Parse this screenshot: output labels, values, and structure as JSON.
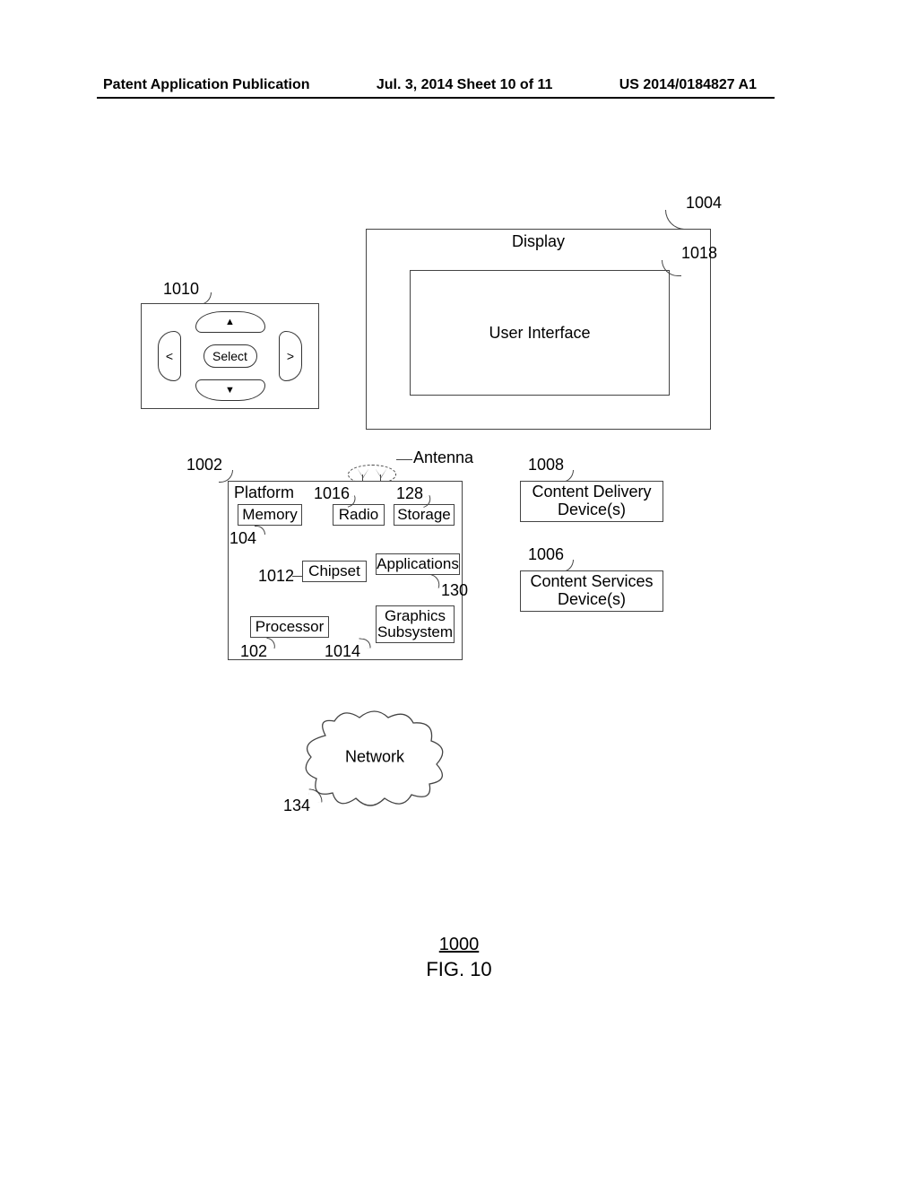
{
  "header": {
    "left": "Patent Application Publication",
    "middle": "Jul. 3, 2014  Sheet 10 of 11",
    "right": "US 2014/0184827 A1"
  },
  "figure": {
    "number": "1000",
    "label": "FIG. 10"
  },
  "display": {
    "title": "Display",
    "ui": "User Interface"
  },
  "remote": {
    "select": "Select"
  },
  "platform": {
    "title": "Platform",
    "memory": "Memory",
    "radio": "Radio",
    "storage": "Storage",
    "chipset": "Chipset",
    "applications": "Applications",
    "processor": "Processor",
    "graphics": "Graphics Subsystem"
  },
  "antenna_label": "Antenna",
  "right_boxes": {
    "content_delivery": "Content Delivery Device(s)",
    "content_services": "Content Services Device(s)"
  },
  "network": "Network",
  "refs": {
    "r1004": "1004",
    "r1018": "1018",
    "r1010": "1010",
    "r1002": "1002",
    "r1016": "1016",
    "r128": "128",
    "r104": "104",
    "r1012": "1012",
    "r130": "130",
    "r102": "102",
    "r1014": "1014",
    "r1008": "1008",
    "r1006": "1006",
    "r134": "134"
  }
}
